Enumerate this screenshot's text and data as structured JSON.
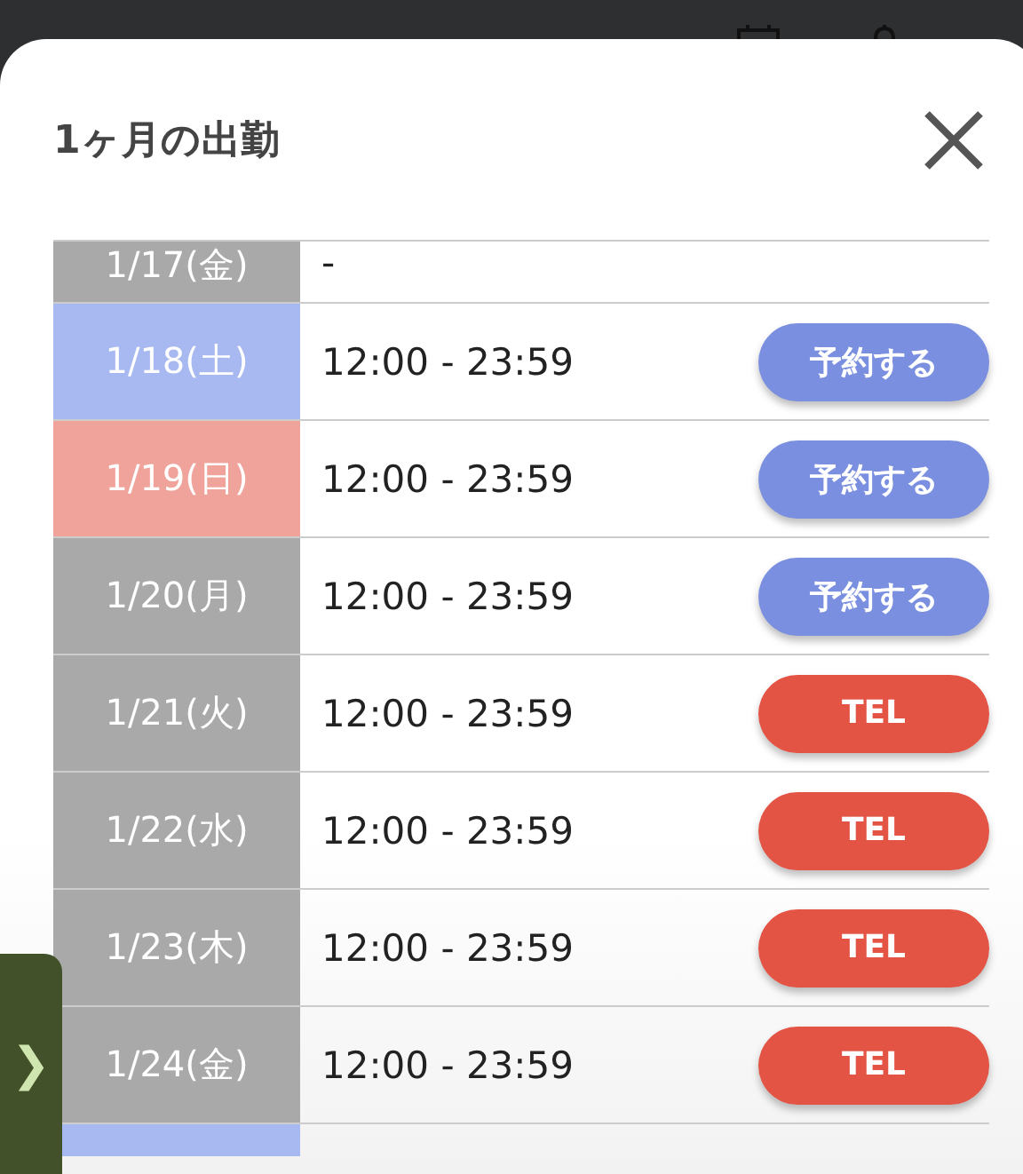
{
  "modal": {
    "title": "1ヶ月の出勤"
  },
  "rows": [
    {
      "date": "1/17(金)",
      "color": "#a9a9a9",
      "hours": "-",
      "partial": true
    },
    {
      "date": "1/18(土)",
      "color": "#a8b8f0",
      "hours": "12:00 - 23:59",
      "action": {
        "kind": "reserve",
        "label": "予約する"
      }
    },
    {
      "date": "1/19(日)",
      "color": "#f0a39b",
      "hours": "12:00 - 23:59",
      "action": {
        "kind": "reserve",
        "label": "予約する"
      }
    },
    {
      "date": "1/20(月)",
      "color": "#a9a9a9",
      "hours": "12:00 - 23:59",
      "action": {
        "kind": "reserve",
        "label": "予約する"
      }
    },
    {
      "date": "1/21(火)",
      "color": "#a9a9a9",
      "hours": "12:00 - 23:59",
      "action": {
        "kind": "tel",
        "label": "TEL"
      }
    },
    {
      "date": "1/22(水)",
      "color": "#a9a9a9",
      "hours": "12:00 - 23:59",
      "action": {
        "kind": "tel",
        "label": "TEL"
      }
    },
    {
      "date": "1/23(木)",
      "color": "#a9a9a9",
      "hours": "12:00 - 23:59",
      "action": {
        "kind": "tel",
        "label": "TEL"
      }
    },
    {
      "date": "1/24(金)",
      "color": "#a9a9a9",
      "hours": "12:00 - 23:59",
      "action": {
        "kind": "tel",
        "label": "TEL"
      }
    },
    {
      "color": "#a8b8f0",
      "partial": true
    }
  ],
  "side_tab": {
    "label": "❯"
  }
}
